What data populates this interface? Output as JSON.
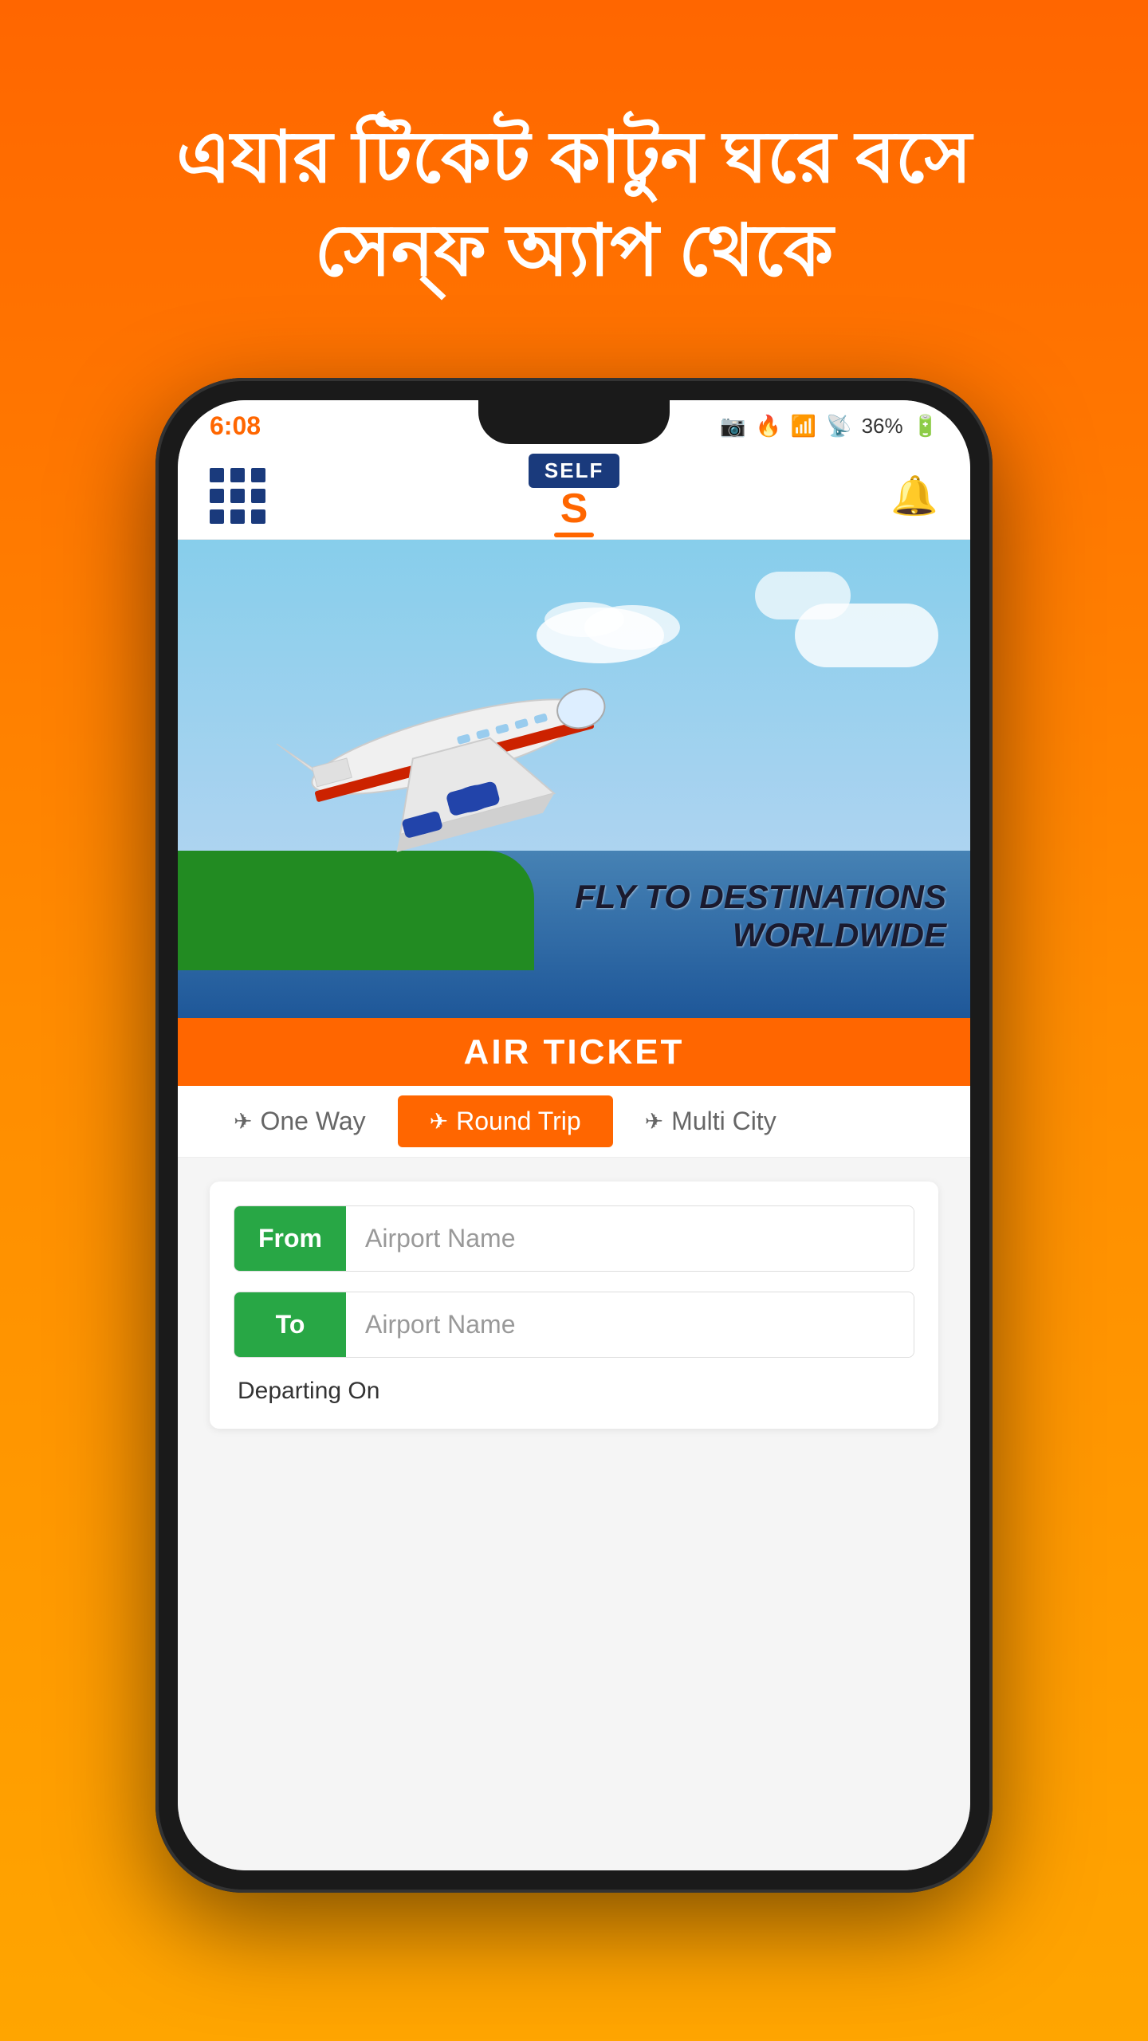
{
  "hero": {
    "text_line1": "এযার টিকেট কাটুন ঘরে বসে",
    "text_line2": "সেন্ফ অ্যাপ থেকে"
  },
  "status_bar": {
    "time": "6:08",
    "battery": "36%",
    "icons": "📷 🔔 📶"
  },
  "nav": {
    "logo_badge": "SELF",
    "logo_char": "S"
  },
  "banner": {
    "line1": "FLY TO DESTINATIONS",
    "line2": "WORLDWIDE"
  },
  "ticket_header": {
    "label": "AIR TICKET"
  },
  "tabs": {
    "one_way": "One Way",
    "round_trip": "Round Trip",
    "multi_city": "Multi City"
  },
  "form": {
    "from_label": "From",
    "from_placeholder": "Airport Name",
    "to_label": "To",
    "to_placeholder": "Airport Name",
    "departing_label": "Departing On"
  },
  "colors": {
    "orange": "#FF6600",
    "green": "#28a745",
    "navy": "#1a3a7c"
  }
}
